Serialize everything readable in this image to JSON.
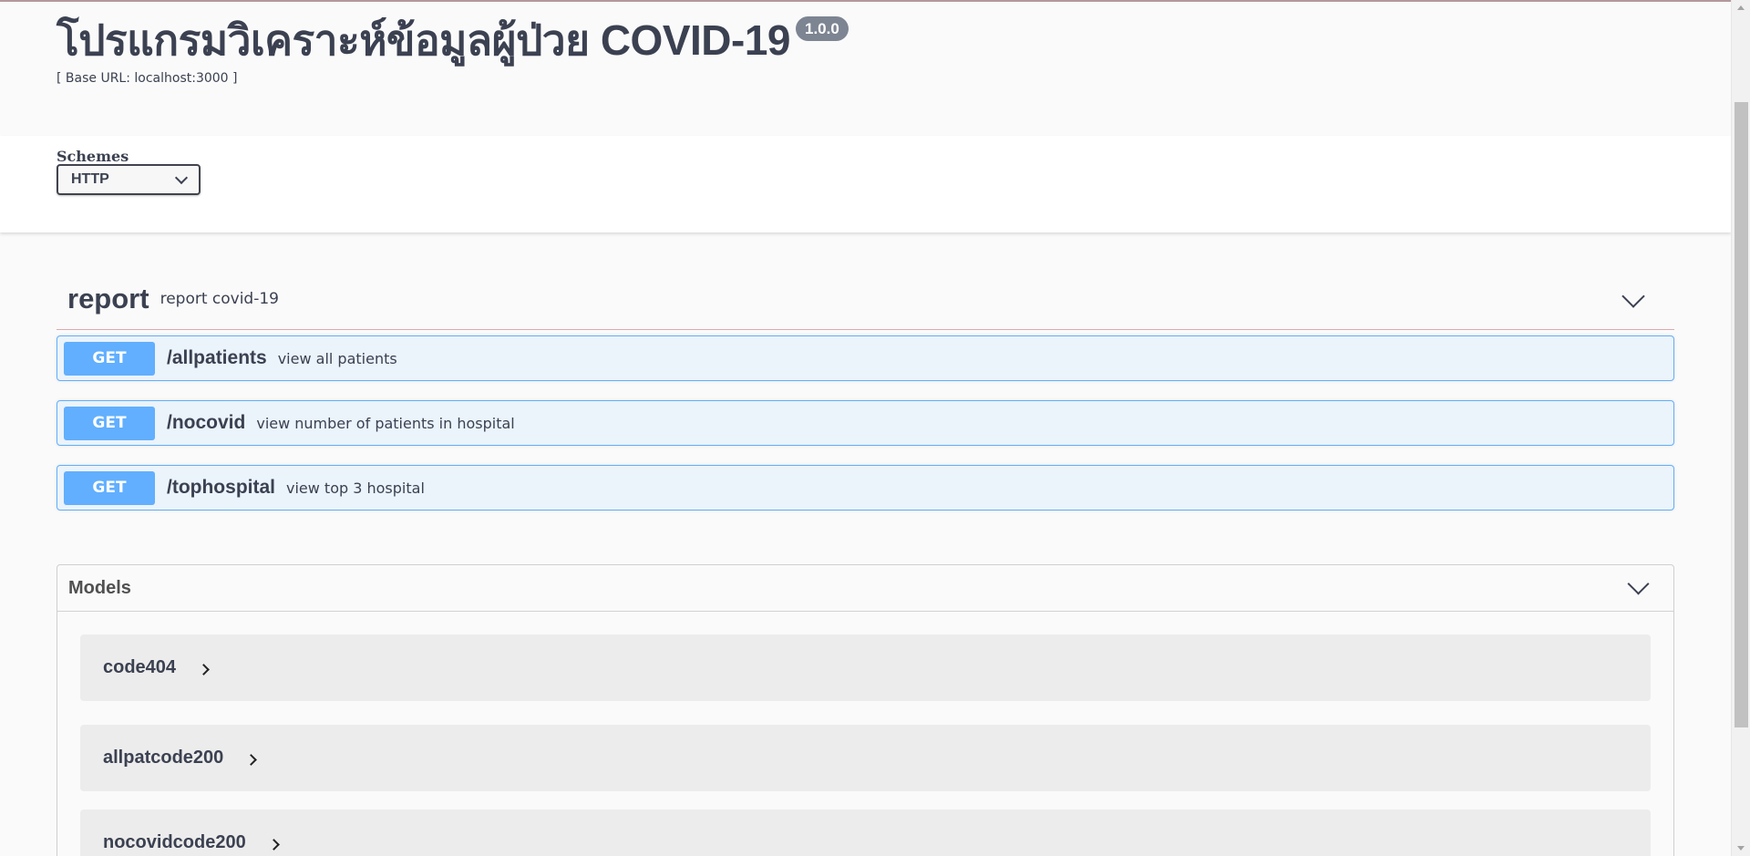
{
  "info": {
    "title": "โปรแกรมวิเคราะห์ข้อมูลผู้ป่วย COVID-19",
    "version": "1.0.0",
    "base_url": "[ Base URL: localhost:3000 ]"
  },
  "schemes": {
    "label": "Schemes",
    "selected": "HTTP"
  },
  "tag": {
    "name": "report",
    "description": "report covid-19"
  },
  "operations": [
    {
      "method": "GET",
      "path": "/allpatients",
      "description": "view all patients"
    },
    {
      "method": "GET",
      "path": "/nocovid",
      "description": "view number of patients in hospital"
    },
    {
      "method": "GET",
      "path": "/tophospital",
      "description": "view top 3 hospital"
    }
  ],
  "models": {
    "title": "Models",
    "items": [
      {
        "name": "code404"
      },
      {
        "name": "allpatcode200"
      },
      {
        "name": "nocovidcode200"
      },
      {
        "name": ""
      }
    ]
  },
  "colors": {
    "get_method": "#61affe",
    "get_bg": "#ebf3fb",
    "version_badge": "#7d8492"
  }
}
